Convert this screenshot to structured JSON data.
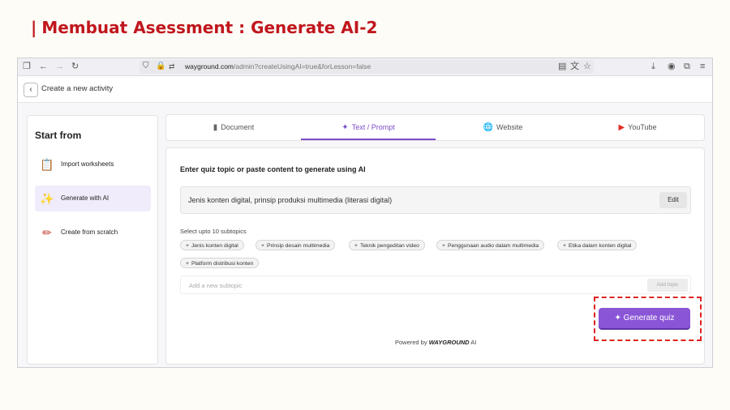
{
  "slide": {
    "title_bar": "|",
    "title": "Membuat Asessment : Generate AI-2"
  },
  "browser": {
    "url_host": "wayground.com",
    "url_path": "/admin?createUsingAI=true&forLesson=false"
  },
  "app": {
    "back_icon": "‹",
    "header_title": "Create a new activity"
  },
  "sidebar": {
    "heading": "Start from",
    "items": [
      {
        "label": "Import worksheets",
        "icon": "worksheet-icon"
      },
      {
        "label": "Generate with AI",
        "icon": "sparkle-icon",
        "active": true
      },
      {
        "label": "Create from scratch",
        "icon": "pencil-icon"
      }
    ]
  },
  "tabs": [
    {
      "label": "Document",
      "icon": "document-icon"
    },
    {
      "label": "Text / Prompt",
      "icon": "sparkle-icon",
      "active": true
    },
    {
      "label": "Website",
      "icon": "globe-icon"
    },
    {
      "label": "YouTube",
      "icon": "youtube-icon"
    }
  ],
  "main": {
    "heading": "Enter quiz topic or paste content to generate using AI",
    "topic_value": "Jenis konten digital, prinsip produksi multimedia (literasi digital)",
    "edit_label": "Edit",
    "subtopics_label": "Select upto 10 subtopics",
    "subtopics": [
      "Jenis konten digital",
      "Prinsip desain multimedia",
      "Teknik pengeditan video",
      "Penggunaan audio dalam multimedia",
      "Etika dalam konten digital",
      "Platform distribusi konten"
    ],
    "add_placeholder": "Add a new subtopic",
    "add_button": "Add topic",
    "generate_label": "Generate quiz",
    "powered_prefix": "Powered by",
    "powered_brand": "WAYGROUND",
    "powered_suffix": "AI"
  },
  "colors": {
    "accent": "#8a55d6",
    "title_red": "#c0161c",
    "highlight": "#e02020"
  }
}
